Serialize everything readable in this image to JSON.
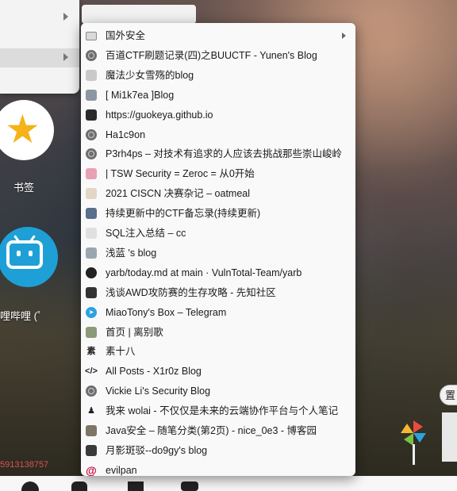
{
  "context_menu": {
    "rows": [
      {
        "label": "",
        "has_submenu": true
      },
      {
        "label": "",
        "has_submenu": true
      }
    ]
  },
  "tiles": [
    {
      "label": "书签",
      "icon": "star-icon",
      "color": "#f3b319"
    },
    {
      "label": "哩哔哩 (゜",
      "icon": "bilibili-tv-icon",
      "color": "#1ea0d6"
    }
  ],
  "bookmarks": [
    {
      "label": "国外安全",
      "icon": "folder-icon",
      "type": "folder"
    },
    {
      "label": "百道CTF刷题记录(四)之BUUCTF - Yunen's Blog",
      "icon": "globe-icon"
    },
    {
      "label": "魔法少女雪殇的blog",
      "icon": "anime-favicon"
    },
    {
      "label": "[ Mi1k7ea ]Blog",
      "icon": "avatar-favicon"
    },
    {
      "label": "https://guokeya.github.io",
      "icon": "silhouette-favicon"
    },
    {
      "label": "Ha1c9on",
      "icon": "globe-icon"
    },
    {
      "label": "P3rh4ps – 对技术有追求的人应该去挑战那些崇山峻岭",
      "icon": "globe-icon"
    },
    {
      "label": "| TSW Security = Zeroc = 从0开始",
      "icon": "pink-favicon"
    },
    {
      "label": "2021 CISCN 决赛杂记 – oatmeal",
      "icon": "cloud-favicon"
    },
    {
      "label": "持续更新中的CTF备忘录(持续更新)",
      "icon": "image-favicon"
    },
    {
      "label": "SQL注入总结 – cc",
      "icon": "blank-favicon"
    },
    {
      "label": "浅蓝 's blog",
      "icon": "eye-favicon"
    },
    {
      "label": "yarb/today.md at main · VulnTotal-Team/yarb",
      "icon": "github-icon"
    },
    {
      "label": "浅谈AWD攻防赛的生存攻略 - 先知社区",
      "icon": "xianzhi-icon"
    },
    {
      "label": "MiaoTony's Box – Telegram",
      "icon": "telegram-icon"
    },
    {
      "label": "首页 | 离别歌",
      "icon": "leaf-favicon"
    },
    {
      "label": "素十八",
      "icon": "su-favicon"
    },
    {
      "label": "All Posts - X1r0z Blog",
      "icon": "code-icon"
    },
    {
      "label": "Vickie Li's Security Blog",
      "icon": "globe-icon"
    },
    {
      "label": "我来 wolai - 不仅仅是未来的云端协作平台与个人笔记",
      "icon": "wolai-icon"
    },
    {
      "label": "Java安全 – 随笔分类(第2页) - nice_0e3 - 博客园",
      "icon": "photo-favicon"
    },
    {
      "label": "月影斑驳--do9gy's blog",
      "icon": "dark-favicon"
    },
    {
      "label": "evilpan",
      "icon": "debian-icon"
    }
  ],
  "right_edge": {
    "button_label": "置"
  },
  "phone_fragment": "5913138757",
  "colors": {
    "folder": "#d9d9d9",
    "telegram": "#2aa3e0",
    "bilibili": "#1ea0d6",
    "star": "#f3b319"
  }
}
